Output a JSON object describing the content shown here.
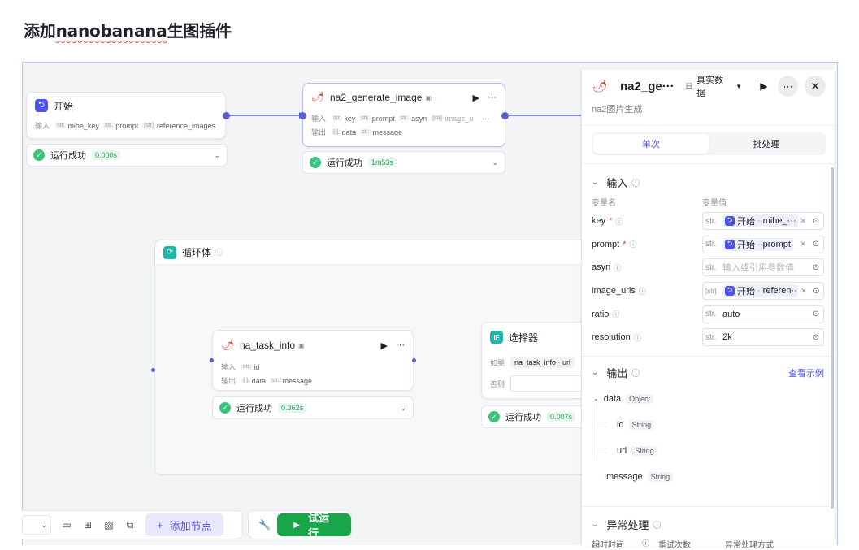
{
  "page": {
    "title_prefix": "添加",
    "title_word": "nanobanana",
    "title_suffix": "生图插件"
  },
  "canvas": {
    "start_node": {
      "title": "开始",
      "input_label": "输入",
      "inputs": [
        {
          "type": "str.",
          "name": "mihe_key"
        },
        {
          "type": "str.",
          "name": "prompt"
        },
        {
          "type": "[str]",
          "name": "reference_images"
        }
      ],
      "status": "运行成功",
      "time": "0.000s"
    },
    "gen_node": {
      "title": "na2_generate_image",
      "input_label": "输入",
      "output_label": "输出",
      "inputs": [
        {
          "type": "str.",
          "name": "key"
        },
        {
          "type": "str.",
          "name": "prompt"
        },
        {
          "type": "str.",
          "name": "asyn"
        },
        {
          "type": "[str]",
          "name": "image_u"
        }
      ],
      "outputs": [
        {
          "type": "{ }",
          "name": "data"
        },
        {
          "type": "str.",
          "name": "message"
        }
      ],
      "status": "运行成功",
      "time": "1m53s"
    },
    "loop": {
      "title": "循环体"
    },
    "task_node": {
      "title": "na_task_info",
      "input_label": "输入",
      "output_label": "输出",
      "inputs": [
        {
          "type": "str.",
          "name": "id"
        }
      ],
      "outputs": [
        {
          "type": "{ }",
          "name": "data"
        },
        {
          "type": "str.",
          "name": "message"
        }
      ],
      "status": "运行成功",
      "time": "0.362s"
    },
    "selector_node": {
      "title": "选择器",
      "if_label": "如果",
      "else_label": "否则",
      "condition": "na_task_info · url",
      "status": "运行成功",
      "time": "0.007s"
    }
  },
  "toolbar": {
    "add_node": "添加节点",
    "run": "试运行"
  },
  "panel": {
    "title": "na2_ge···",
    "data_mode": "真实数据",
    "subtitle": "na2图片生成",
    "tabs": [
      "单次",
      "批处理"
    ],
    "active_tab": 0,
    "input_section": "输入",
    "col_name": "变量名",
    "col_value": "变量值",
    "params": [
      {
        "name": "key",
        "required": true,
        "type": "str.",
        "ref_node": "开始",
        "ref_var": "mihe_···",
        "removable": true
      },
      {
        "name": "prompt",
        "required": true,
        "type": "str.",
        "ref_node": "开始",
        "ref_var": "prompt",
        "removable": true
      },
      {
        "name": "asyn",
        "required": false,
        "type": "str.",
        "placeholder": "输入或引用参数值"
      },
      {
        "name": "image_urls",
        "required": false,
        "type": "[str]",
        "ref_node": "开始",
        "ref_var": "referen···",
        "removable": true
      },
      {
        "name": "ratio",
        "required": false,
        "type": "str.",
        "value": "auto"
      },
      {
        "name": "resolution",
        "required": false,
        "type": "str.",
        "value": "2k"
      }
    ],
    "output_section": "输出",
    "view_example": "查看示例",
    "outputs": {
      "data": {
        "name": "data",
        "type": "Object"
      },
      "id": {
        "name": "id",
        "type": "String"
      },
      "url": {
        "name": "url",
        "type": "String"
      },
      "message": {
        "name": "message",
        "type": "String"
      }
    },
    "error_section": "异常处理",
    "error_cols": [
      "超时时间",
      "重试次数",
      "异常处理方式"
    ]
  },
  "colors": {
    "accent": "#4d53e8",
    "success": "#3ac47d",
    "run": "#19a64a",
    "connector": "#5a5fd6"
  }
}
